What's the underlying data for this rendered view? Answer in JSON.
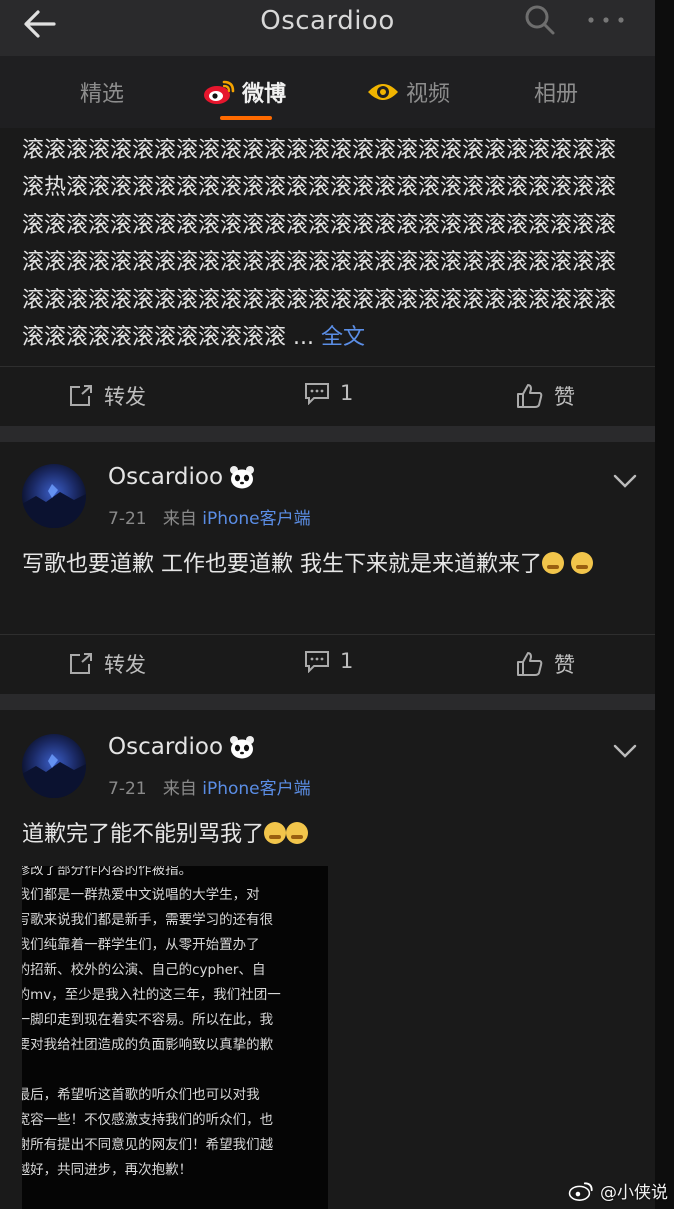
{
  "header": {
    "title": "Oscardioo"
  },
  "tabs": [
    {
      "label": "精选"
    },
    {
      "label": "微博"
    },
    {
      "label": "视频"
    },
    {
      "label": "相册"
    }
  ],
  "post1": {
    "text": "滚滚滚滚滚滚滚滚滚滚滚滚滚滚滚滚滚滚滚滚滚滚滚滚滚滚滚滚热滚滚滚滚滚滚滚滚滚滚滚滚滚滚滚滚滚滚滚滚滚滚滚滚滚滚滚滚滚滚滚滚滚滚滚滚滚滚滚滚滚滚滚滚滚滚滚滚滚滚滚滚滚滚滚滚滚滚滚滚滚滚滚滚滚滚滚滚滚滚滚滚滚滚滚滚滚滚滚滚滚滚滚滚滚滚滚滚滚滚滚滚滚滚滚滚滚滚滚滚滚滚滚滚滚滚滚滚滚滚滚滚滚滚滚滚滚滚",
    "ellipsis": " ...",
    "full_text_link": "全文",
    "actions": {
      "repost": "转发",
      "comments": "1",
      "like": "赞"
    }
  },
  "post2": {
    "author": "Oscardioo",
    "date": "7-21",
    "source_prefix": "来自",
    "source": "iPhone客户端",
    "text": "写歌也要道歉 工作也要道歉 我生下来就是来道歉来了",
    "actions": {
      "repost": "转发",
      "comments": "1",
      "like": "赞"
    }
  },
  "post3": {
    "author": "Oscardioo",
    "date": "7-21",
    "source_prefix": "来自",
    "source": "iPhone客户端",
    "text": "道歉完了能不能别骂我了",
    "image_text": "  修改了部分作内容的作被指。\n  我们都是一群热爱中文说唱的大学生，对\n  写歌来说我们都是新手，需要学习的还有很\n  我们纯靠着一群学生们，从零开始置办了\n  的招新、校外的公演、自己的cypher、自\n  的mv，至少是我入社的这三年，我们社团一\n  一脚印走到现在着实不容易。所以在此，我\n  要对我给社团造成的负面影响致以真挚的歉\n\n  最后，希望听这首歌的听众们也可以对我\n  宽容一些！不仅感激支持我们的听众们，也\n  谢所有提出不同意见的网友们！希望我们越\n  越好，共同进步，再次抱歉！"
  },
  "watermark": {
    "text": "@小侠说"
  }
}
